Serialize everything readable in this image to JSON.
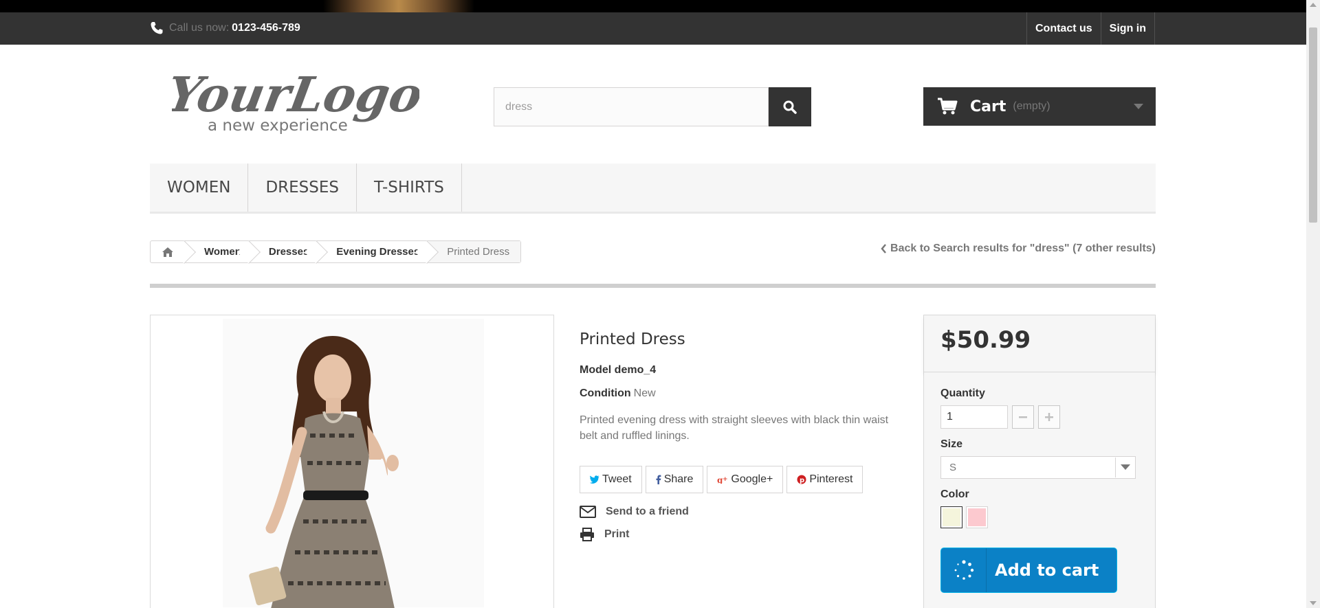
{
  "topbar": {
    "call_label": "Call us now:",
    "phone": "0123-456-789",
    "links": [
      "Contact us",
      "Sign in"
    ]
  },
  "header": {
    "logo_text": "YourLogo",
    "logo_tagline": "a new experience",
    "search": {
      "value": "dress"
    },
    "cart": {
      "label": "Cart",
      "status": "(empty)"
    }
  },
  "menu": {
    "items": [
      "Women",
      "Dresses",
      "T-shirts"
    ]
  },
  "breadcrumb": {
    "items": [
      "Women",
      "Dresses",
      "Evening Dresses"
    ],
    "current": "Printed Dress"
  },
  "back_link": "Back to Search results for \"dress\" (7 other results)",
  "product": {
    "title": "Printed Dress",
    "model_label": "Model",
    "model_value": "demo_4",
    "condition_label": "Condition",
    "condition_value": "New",
    "description": "Printed evening dress with straight sleeves with black thin waist belt and ruffled linings.",
    "social": [
      "Tweet",
      "Share",
      "Google+",
      "Pinterest"
    ],
    "send_to_friend": "Send to a friend",
    "print": "Print"
  },
  "buy_box": {
    "price": "$50.99",
    "quantity_label": "Quantity",
    "quantity_value": "1",
    "size_label": "Size",
    "size_value": "S",
    "color_label": "Color",
    "colors": [
      "#f5f5dc",
      "#fcc9cf"
    ],
    "add_to_cart": "Add to cart"
  },
  "colors": {
    "dark": "#333333",
    "accent": "#0b81c6"
  }
}
